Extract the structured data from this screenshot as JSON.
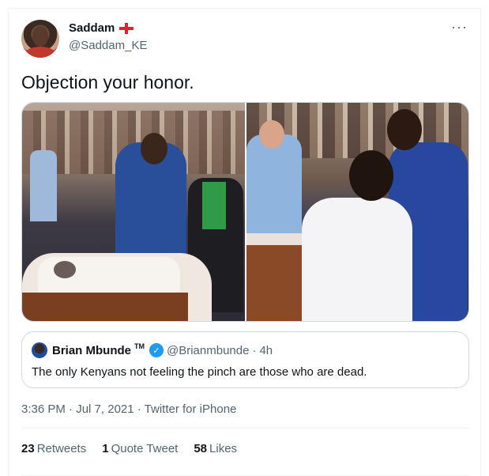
{
  "author": {
    "display_name": "Saddam",
    "handle": "@Saddam_KE",
    "flag_icon": "england-flag-icon"
  },
  "more_icon": "···",
  "tweet": {
    "text": "Objection your honor."
  },
  "quote": {
    "name": "Brian Mbunde",
    "tm": "TM",
    "verified_icon": "✓",
    "handle": "@Brianmbunde",
    "separator": "·",
    "time": "4h",
    "text": "The only Kenyans not feeling the pinch are those who are dead."
  },
  "meta": {
    "time": "3:36 PM",
    "sep1": " · ",
    "date": "Jul 7, 2021",
    "sep2": " · ",
    "source": "Twitter for iPhone"
  },
  "stats": {
    "retweets_count": "23",
    "retweets_label": "Retweets",
    "quotes_count": "1",
    "quotes_label": "Quote Tweet",
    "likes_count": "58",
    "likes_label": "Likes"
  },
  "colors": {
    "verified": "#1d9bf0",
    "secondary_text": "#536471",
    "border": "#cfd9de",
    "flag_red": "#d9232e"
  }
}
